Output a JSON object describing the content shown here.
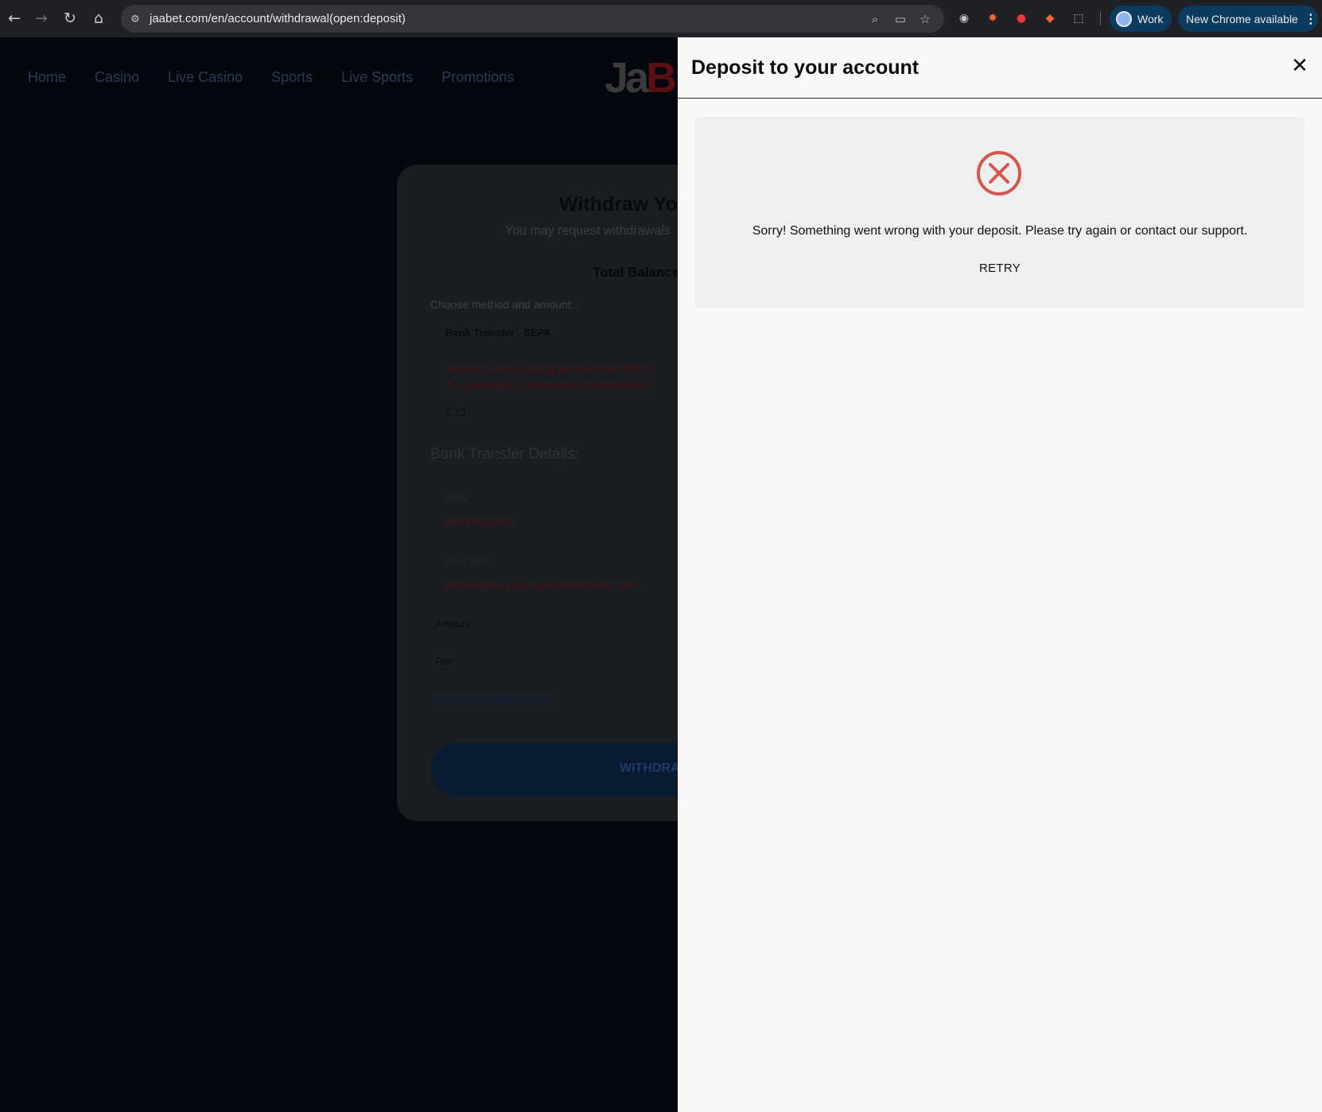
{
  "browser": {
    "url": "jaabet.com/en/account/withdrawal(open:deposit)",
    "profile_label": "Work",
    "update_label": "New Chrome available"
  },
  "site": {
    "nav": [
      "Home",
      "Casino",
      "Live Casino",
      "Sports",
      "Live Sports",
      "Promotions"
    ],
    "logo_text": "JaaB"
  },
  "withdraw": {
    "title": "Withdraw Yo",
    "subtitle": "You may request withdrawals",
    "total_balance": "Total Balance",
    "choose_method": "Choose method and amount:",
    "method": "Bank Transfer - SEPA",
    "error_min": "Minimum amount has to be more than €50.00",
    "error_max": "The withdrawal amount cannot exceed the ac",
    "amount_value": "€  10",
    "bank_details_title": "Bank Transfer Details:",
    "iban_placeholder": "IBAN",
    "iban_error": "IBAN required.",
    "bic_placeholder": "BIC / Swift",
    "bic_error": "Please enter your bank international code.",
    "amount_label": "Amount:",
    "fee_label": "Fee:",
    "final_label": "Final Withdrawal Amount:",
    "button_label": "WITHDRA"
  },
  "drawer": {
    "title": "Deposit to your account",
    "error_message": "Sorry! Something went wrong with your deposit. Please try again or contact our support.",
    "retry_label": "RETRY",
    "error_color": "#d9534f"
  }
}
